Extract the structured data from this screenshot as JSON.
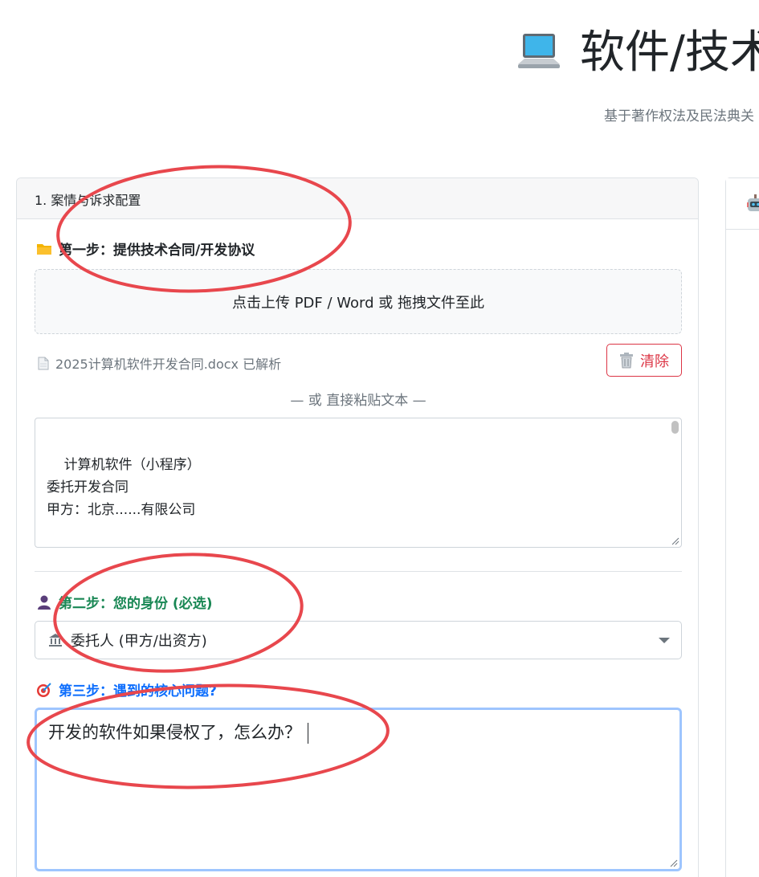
{
  "header": {
    "title": "软件/技术",
    "subtitle": "基于著作权法及民法典关"
  },
  "card": {
    "header_title": "1. 案情与诉求配置"
  },
  "step1": {
    "label": "第一步：提供技术合同/开发协议",
    "upload_text": "点击上传 PDF / Word 或 拖拽文件至此",
    "file_status": "2025计算机软件开发合同.docx 已解析",
    "clear_label": "清除",
    "or_text": "— 或 直接粘贴文本 —",
    "contract_text": "计算机软件（小程序）\n委托开发合同\n甲方：北京......有限公司\n\n乙方：......"
  },
  "step2": {
    "label": "第二步：您的身份 (必选)",
    "selected": "委托人 (甲方/出资方)"
  },
  "step3": {
    "label": "第三步：遇到的核心问题?",
    "question_value": "开发的软件如果侵权了，怎么办？"
  },
  "icons": {
    "title": "laptop-icon",
    "step1": "folder-icon",
    "file": "document-icon",
    "clear": "trash-icon",
    "step2": "user-icon",
    "select": "bank-icon",
    "step3": "target-icon",
    "right_panel": "robot-icon"
  },
  "colors": {
    "step2": "#198754",
    "step3": "#0d6efd",
    "clear": "#dc3545",
    "annotation": "#e8474d",
    "focus": "#9ec5fe"
  }
}
